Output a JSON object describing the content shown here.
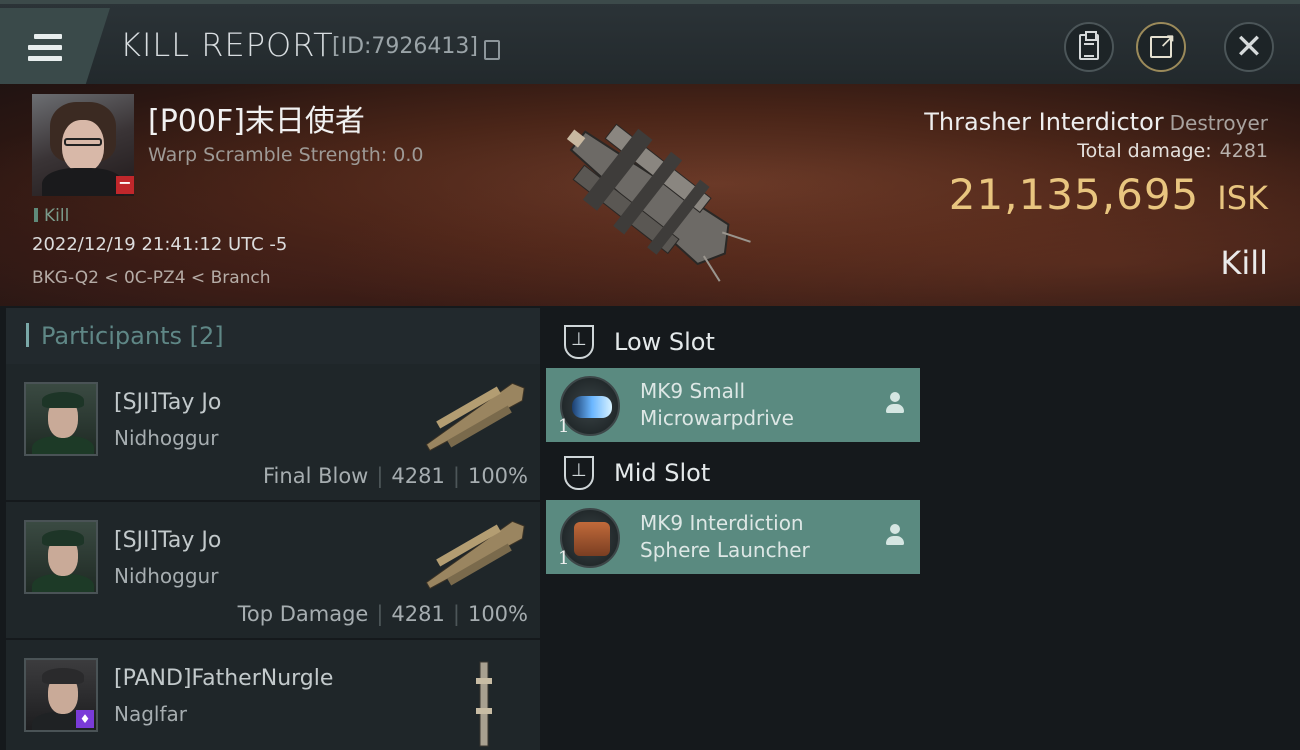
{
  "header": {
    "title": "KILL REPORT",
    "report_id": "[ID:7926413]"
  },
  "victim": {
    "name": "[P00F]末日使者",
    "warp_strength": "Warp Scramble Strength: 0.0",
    "tag": "Kill",
    "timestamp": "2022/12/19 21:41:12 UTC -5",
    "location": "BKG-Q2 < 0C-PZ4 < Branch",
    "ship_name": "Thrasher Interdictor",
    "ship_class": "Destroyer",
    "total_damage_label": "Total damage:",
    "total_damage": "4281",
    "isk_value": "21,135,695",
    "isk_unit": "ISK",
    "result": "Kill"
  },
  "participants": {
    "header": "Participants [2]",
    "rows": [
      {
        "name": "[SJI]Tay Jo",
        "ship": "Nidhoggur",
        "role": "Final Blow",
        "damage": "4281",
        "percent": "100%"
      },
      {
        "name": "[SJI]Tay Jo",
        "ship": "Nidhoggur",
        "role": "Top Damage",
        "damage": "4281",
        "percent": "100%"
      },
      {
        "name": "[PAND]FatherNurgle",
        "ship": "Naglfar"
      }
    ]
  },
  "fittings": {
    "low_slot_label": "Low Slot",
    "mid_slot_label": "Mid Slot",
    "low_modules": [
      {
        "line1": "MK9 Small",
        "line2": "Microwarpdrive",
        "qty": "1",
        "icon": "microwarpdrive-icon"
      }
    ],
    "mid_modules": [
      {
        "line1": "MK9 Interdiction",
        "line2": "Sphere Launcher",
        "qty": "1",
        "icon": "interdiction-launcher-icon"
      }
    ]
  },
  "colors": {
    "accent_teal": "#5a8a80",
    "isk_gold": "#e8c57f",
    "loss_red": "#c0272b"
  }
}
